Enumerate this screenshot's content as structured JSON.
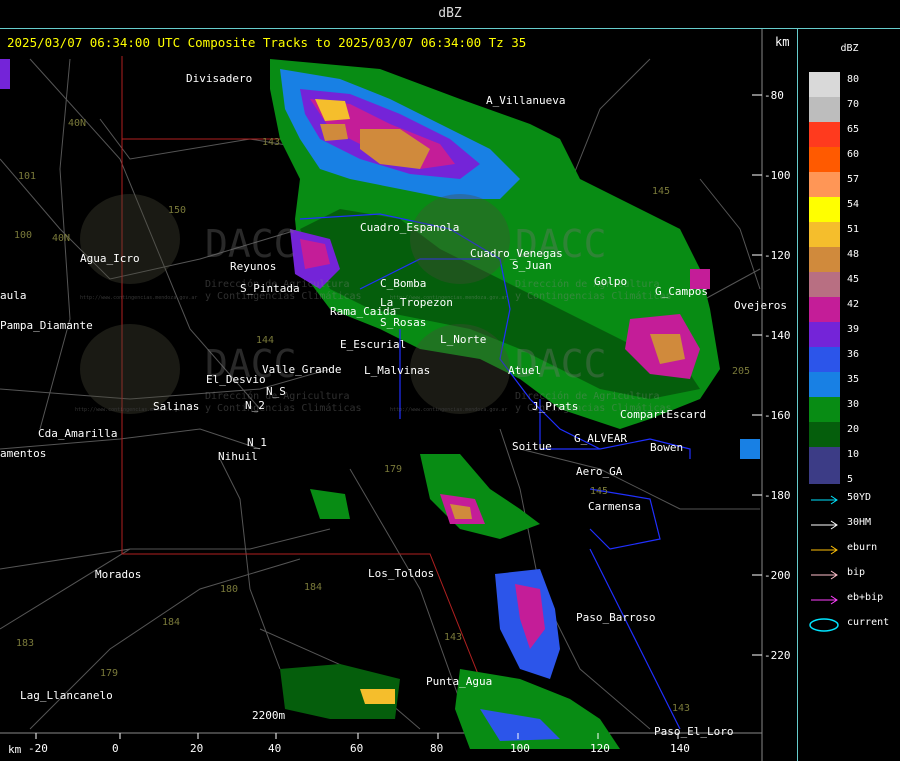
{
  "header": {
    "title": "dBZ"
  },
  "map": {
    "headline": "2025/03/07 06:34:00 UTC Composite Tracks to 2025/03/07 06:34:00 Tz 35",
    "unit_top": "km",
    "unit_bottom": "km",
    "x_ticks": [
      "-20",
      "0",
      "20",
      "40",
      "60",
      "80",
      "100",
      "120",
      "140"
    ],
    "y_ticks": [
      "-80",
      "-100",
      "-120",
      "-140",
      "-160",
      "-180",
      "-200",
      "-220"
    ],
    "place_labels": [
      "Divisadero",
      "A_Villanueva",
      "Agua_Icro",
      "Reyunos",
      "S_Pintada",
      "Pampa_Diamante",
      "El_Desvio",
      "Valle_Grande",
      "Salinas",
      "N_2",
      "N_S",
      "N_1",
      "Nihuil",
      "Cda_Amarilla",
      "amentos",
      "Morados",
      "Lag_Llancanelo",
      "Los_Toldos",
      "Punta_Agua",
      "Paso_Barroso",
      "Paso_El_Loro",
      "Carmensa",
      "Bowen",
      "Soitue",
      "G_ALVEAR",
      "Aero_GA",
      "CompartEscard",
      "J_Prats",
      "Atuel",
      "Rama_Caida",
      "E_Escurial",
      "L_Malvinas",
      "S_Rosas",
      "C_Bomba",
      "Cuadro_Espanola",
      "Golpo",
      "G_Campos",
      "Ovejeros",
      "La_Tropezon",
      "L_Norte",
      "S_Juan",
      "Cuadro_Venegas",
      "aula",
      "2200m"
    ],
    "route_labels": [
      "143",
      "150",
      "101",
      "40N",
      "40N",
      "100",
      "144",
      "179",
      "180",
      "184",
      "184",
      "183",
      "179",
      "143",
      "145",
      "145",
      "205",
      "143"
    ],
    "watermark_title": "DACC",
    "watermark_sub1": "Dirección de Agricultura",
    "watermark_sub2": "y Contingencias Climáticas",
    "watermark_url": "http://www.contingencias.mendoza.gov.ar"
  },
  "legend": {
    "title": "dBZ",
    "levels": [
      {
        "value": "80",
        "color": "#d9d9d9"
      },
      {
        "value": "70",
        "color": "#bdbdbd"
      },
      {
        "value": "65",
        "color": "#ff3a1e"
      },
      {
        "value": "60",
        "color": "#ff5a00"
      },
      {
        "value": "57",
        "color": "#ff9656"
      },
      {
        "value": "54",
        "color": "#ffff00"
      },
      {
        "value": "51",
        "color": "#f5be2c"
      },
      {
        "value": "48",
        "color": "#d08a3c"
      },
      {
        "value": "45",
        "color": "#b86f82"
      },
      {
        "value": "42",
        "color": "#c41d98"
      },
      {
        "value": "39",
        "color": "#7424d8"
      },
      {
        "value": "36",
        "color": "#2c55ea"
      },
      {
        "value": "35",
        "color": "#1880e4"
      },
      {
        "value": "30",
        "color": "#088c14"
      },
      {
        "value": "20",
        "color": "#055e0c"
      },
      {
        "value": "10",
        "color": "#3c3c86"
      },
      {
        "value": "5",
        "color": "#3c3c86"
      }
    ],
    "tracks": [
      {
        "label": "50YD",
        "color": "#00e5ff"
      },
      {
        "label": "30HM",
        "color": "#ffffff"
      },
      {
        "label": "eburn",
        "color": "#ffc107"
      },
      {
        "label": "bip",
        "color": "#ffc0cb"
      },
      {
        "label": "eb+bip",
        "color": "#ff40ff"
      },
      {
        "label": "current",
        "color": "#00e5ff"
      }
    ]
  }
}
